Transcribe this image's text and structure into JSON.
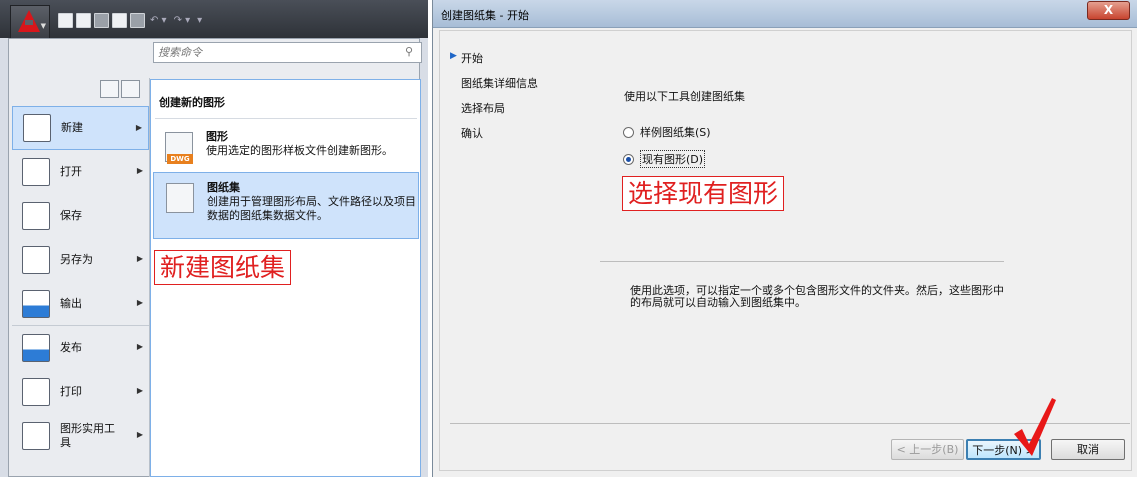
{
  "left_menu": {
    "search_placeholder": "搜索命令",
    "commands": [
      {
        "label": "新建",
        "has_submenu": true,
        "selected": true
      },
      {
        "label": "打开",
        "has_submenu": true
      },
      {
        "label": "保存",
        "has_submenu": false
      },
      {
        "label": "另存为",
        "has_submenu": true
      },
      {
        "label": "输出",
        "has_submenu": true
      },
      {
        "label": "发布",
        "has_submenu": true
      },
      {
        "label": "打印",
        "has_submenu": true
      },
      {
        "label": "图形实用工具",
        "has_submenu": true
      }
    ],
    "submenu": {
      "header": "创建新的图形",
      "items": [
        {
          "title": "图形",
          "description": "使用选定的图形样板文件创建新图形。",
          "badge": "DWG"
        },
        {
          "title": "图纸集",
          "description": "创建用于管理图形布局、文件路径以及项目数据的图纸集数据文件。",
          "selected": true
        }
      ]
    },
    "annotation": "新建图纸集"
  },
  "dialog": {
    "title": "创建图纸集 - 开始",
    "close_label": "X",
    "steps": [
      "开始",
      "图纸集详细信息",
      "选择布局",
      "确认"
    ],
    "current_step": "开始",
    "intro": "使用以下工具创建图纸集",
    "options": [
      {
        "label": "样例图纸集(S)",
        "checked": false
      },
      {
        "label": "现有图形(D)",
        "checked": true
      }
    ],
    "annotation": "选择现有图形",
    "description": "使用此选项，可以指定一个或多个包含图形文件的文件夹。然后，这些图形中的布局就可以自动输入到图纸集中。",
    "buttons": {
      "back": "< 上一步(B)",
      "next": "下一步(N) >",
      "cancel": "取消"
    }
  },
  "colors": {
    "annotation": "#e02020",
    "selection": "#cfe3fb",
    "autocad_red": "#d8161b"
  },
  "icons": [
    "autocad-logo-icon",
    "search-icon",
    "dwg-file-icon",
    "sheetset-icon",
    "red-checkmark-icon"
  ]
}
